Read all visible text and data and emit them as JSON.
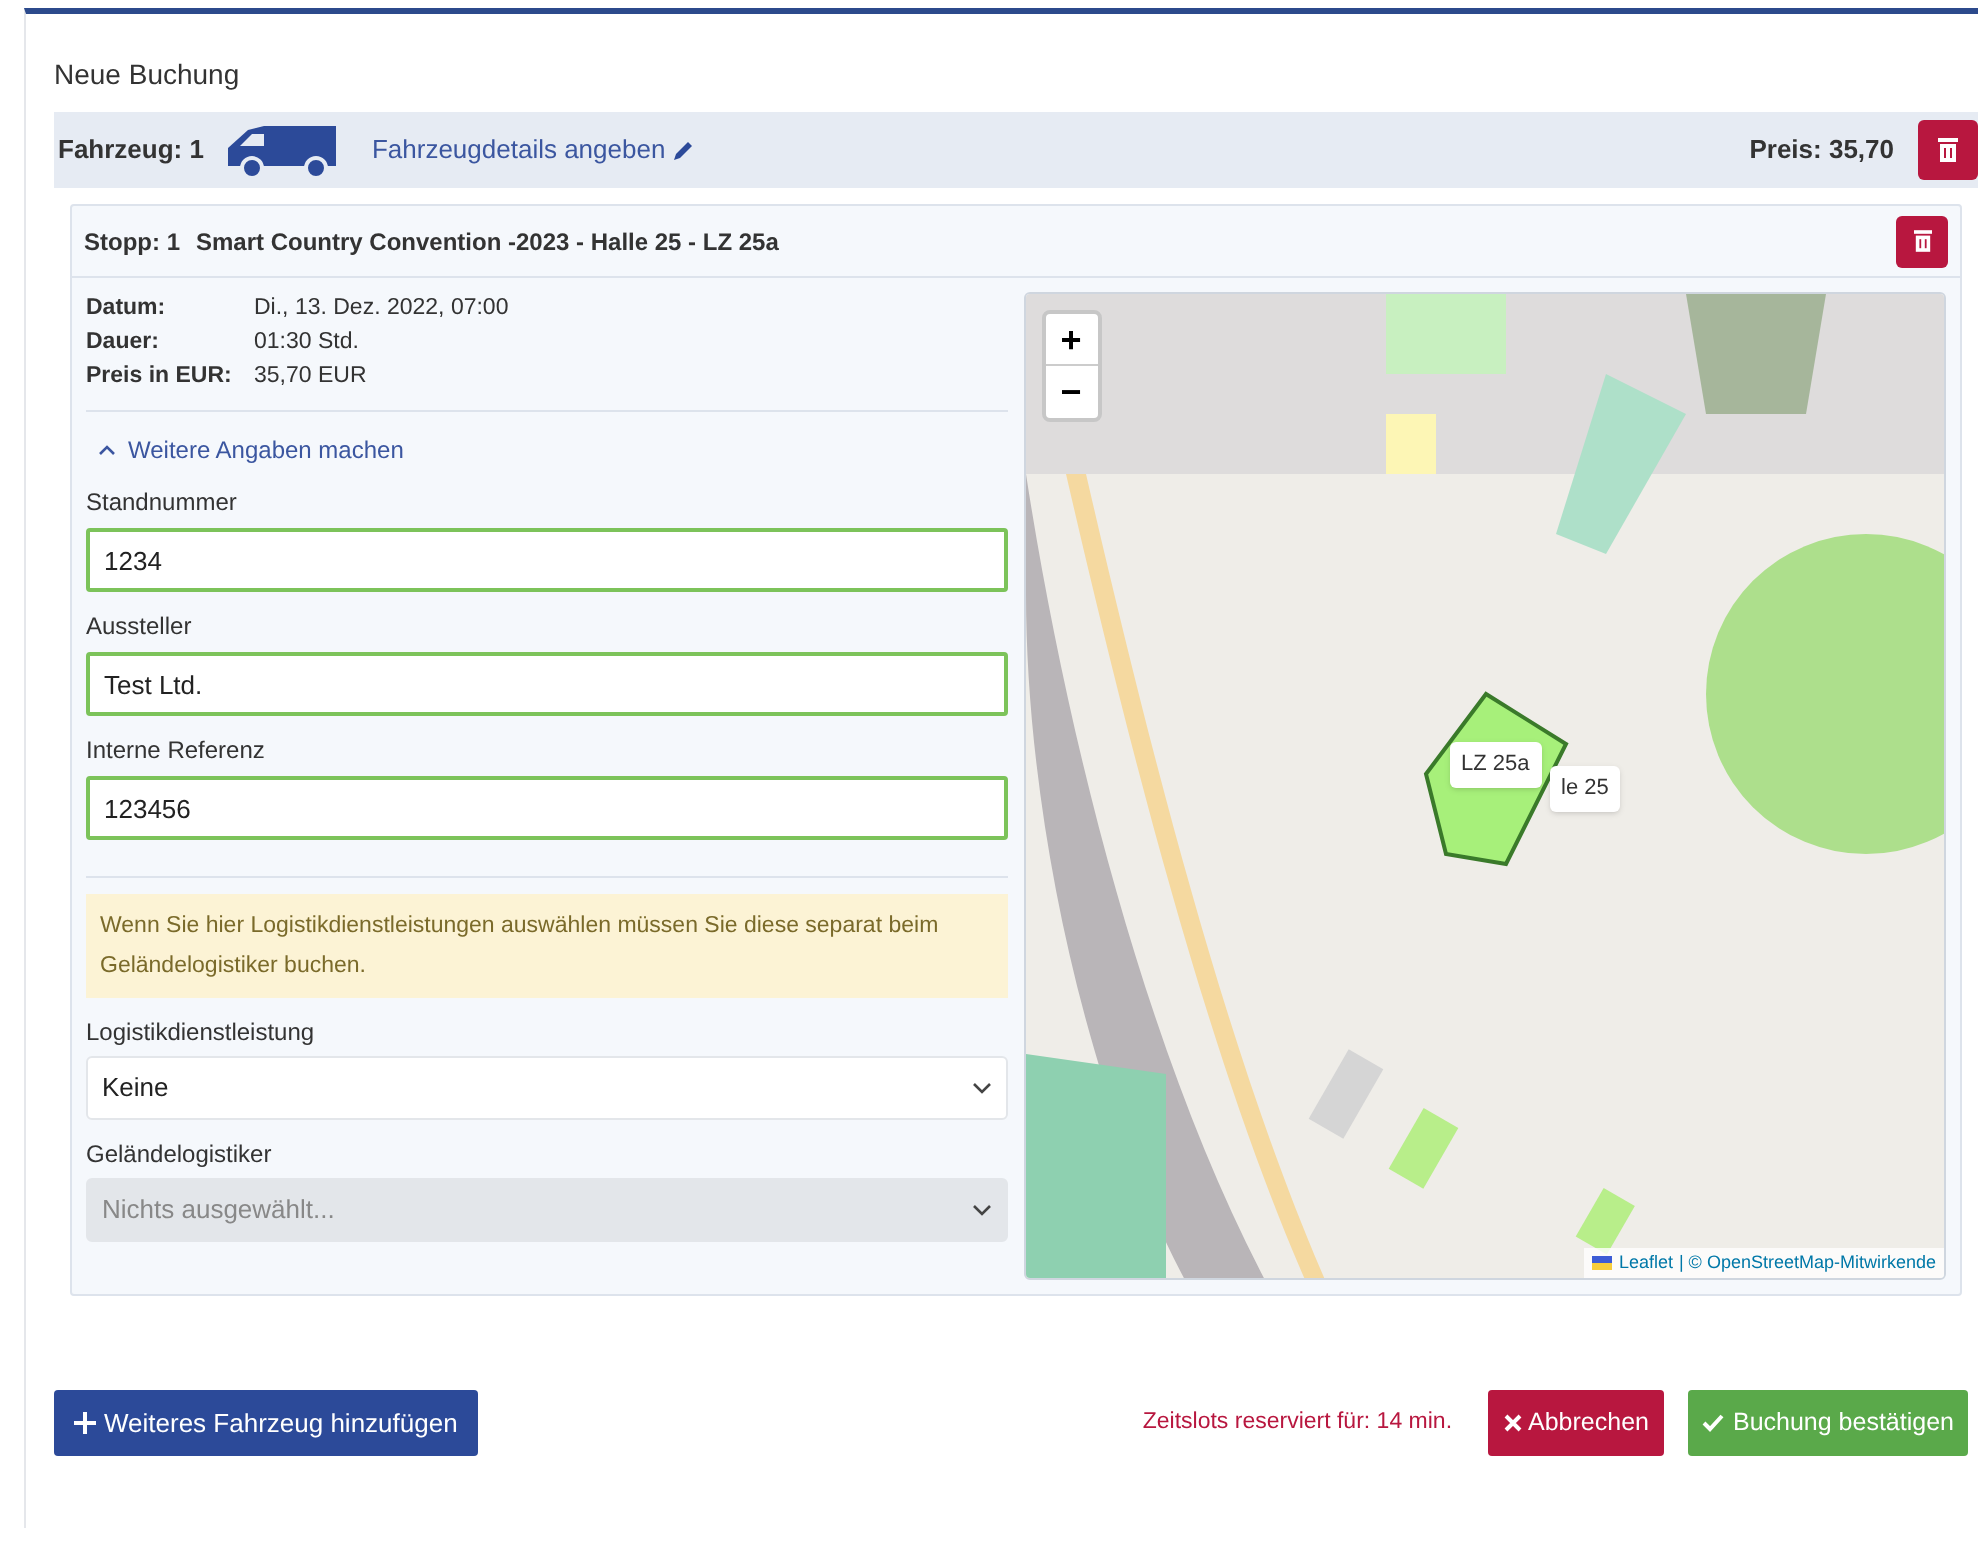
{
  "title": "Neue Buchung",
  "vehicle": {
    "label": "Fahrzeug: 1",
    "details_link": "Fahrzeugdetails angeben",
    "price": "Preis: 35,70"
  },
  "stop": {
    "title": "Stopp: 1",
    "location": "Smart Country Convention -2023 - Halle 25 - LZ 25a",
    "info": [
      {
        "label": "Datum:",
        "value": "Di., 13. Dez. 2022, 07:00"
      },
      {
        "label": "Dauer:",
        "value": "01:30 Std."
      },
      {
        "label": "Preis in EUR:",
        "value": "35,70 EUR"
      }
    ],
    "toggle": {
      "label": "Weitere Angaben machen",
      "expanded": true
    },
    "fields": [
      {
        "label": "Standnummer",
        "value": "1234",
        "valid": true
      },
      {
        "label": "Aussteller",
        "value": "Test Ltd.",
        "valid": true
      },
      {
        "label": "Interne Referenz",
        "value": "123456",
        "valid": true
      }
    ],
    "notice": "Wenn Sie hier Logistikdienstleistungen auswählen müssen Sie diese separat beim Geländelogistiker buchen.",
    "selects": [
      {
        "label": "Logistikdienstleistung",
        "value": "Keine",
        "disabled": false
      },
      {
        "label": "Geländelogistiker",
        "placeholder": "Nichts ausgewählt...",
        "disabled": true
      }
    ],
    "map": {
      "zoom_in": "+",
      "zoom_out": "−",
      "tooltips": [
        {
          "text": "LZ 25a"
        },
        {
          "text": "le 25"
        }
      ],
      "attribution_link": "Leaflet",
      "attribution_text": "| © OpenStreetMap-Mitwirkende"
    }
  },
  "footer": {
    "add_button": "Weiteres Fahrzeug hinzufügen",
    "timer": "Zeitslots reserviert für: 14 min.",
    "cancel_button": "Abbrechen",
    "confirm_button": "Buchung bestätigen"
  }
}
